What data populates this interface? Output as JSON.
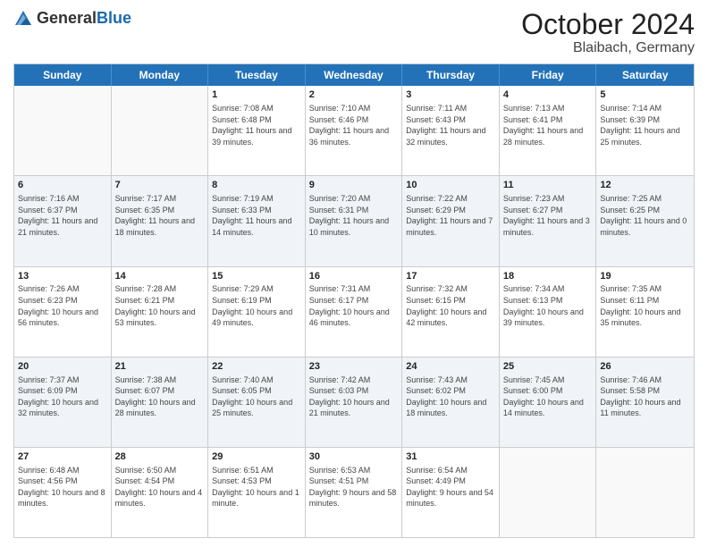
{
  "logo": {
    "text_general": "General",
    "text_blue": "Blue"
  },
  "title": {
    "month": "October 2024",
    "location": "Blaibach, Germany"
  },
  "days_of_week": [
    "Sunday",
    "Monday",
    "Tuesday",
    "Wednesday",
    "Thursday",
    "Friday",
    "Saturday"
  ],
  "weeks": [
    [
      {
        "day": "",
        "info": ""
      },
      {
        "day": "",
        "info": ""
      },
      {
        "day": "1",
        "info": "Sunrise: 7:08 AM\nSunset: 6:48 PM\nDaylight: 11 hours and 39 minutes."
      },
      {
        "day": "2",
        "info": "Sunrise: 7:10 AM\nSunset: 6:46 PM\nDaylight: 11 hours and 36 minutes."
      },
      {
        "day": "3",
        "info": "Sunrise: 7:11 AM\nSunset: 6:43 PM\nDaylight: 11 hours and 32 minutes."
      },
      {
        "day": "4",
        "info": "Sunrise: 7:13 AM\nSunset: 6:41 PM\nDaylight: 11 hours and 28 minutes."
      },
      {
        "day": "5",
        "info": "Sunrise: 7:14 AM\nSunset: 6:39 PM\nDaylight: 11 hours and 25 minutes."
      }
    ],
    [
      {
        "day": "6",
        "info": "Sunrise: 7:16 AM\nSunset: 6:37 PM\nDaylight: 11 hours and 21 minutes."
      },
      {
        "day": "7",
        "info": "Sunrise: 7:17 AM\nSunset: 6:35 PM\nDaylight: 11 hours and 18 minutes."
      },
      {
        "day": "8",
        "info": "Sunrise: 7:19 AM\nSunset: 6:33 PM\nDaylight: 11 hours and 14 minutes."
      },
      {
        "day": "9",
        "info": "Sunrise: 7:20 AM\nSunset: 6:31 PM\nDaylight: 11 hours and 10 minutes."
      },
      {
        "day": "10",
        "info": "Sunrise: 7:22 AM\nSunset: 6:29 PM\nDaylight: 11 hours and 7 minutes."
      },
      {
        "day": "11",
        "info": "Sunrise: 7:23 AM\nSunset: 6:27 PM\nDaylight: 11 hours and 3 minutes."
      },
      {
        "day": "12",
        "info": "Sunrise: 7:25 AM\nSunset: 6:25 PM\nDaylight: 11 hours and 0 minutes."
      }
    ],
    [
      {
        "day": "13",
        "info": "Sunrise: 7:26 AM\nSunset: 6:23 PM\nDaylight: 10 hours and 56 minutes."
      },
      {
        "day": "14",
        "info": "Sunrise: 7:28 AM\nSunset: 6:21 PM\nDaylight: 10 hours and 53 minutes."
      },
      {
        "day": "15",
        "info": "Sunrise: 7:29 AM\nSunset: 6:19 PM\nDaylight: 10 hours and 49 minutes."
      },
      {
        "day": "16",
        "info": "Sunrise: 7:31 AM\nSunset: 6:17 PM\nDaylight: 10 hours and 46 minutes."
      },
      {
        "day": "17",
        "info": "Sunrise: 7:32 AM\nSunset: 6:15 PM\nDaylight: 10 hours and 42 minutes."
      },
      {
        "day": "18",
        "info": "Sunrise: 7:34 AM\nSunset: 6:13 PM\nDaylight: 10 hours and 39 minutes."
      },
      {
        "day": "19",
        "info": "Sunrise: 7:35 AM\nSunset: 6:11 PM\nDaylight: 10 hours and 35 minutes."
      }
    ],
    [
      {
        "day": "20",
        "info": "Sunrise: 7:37 AM\nSunset: 6:09 PM\nDaylight: 10 hours and 32 minutes."
      },
      {
        "day": "21",
        "info": "Sunrise: 7:38 AM\nSunset: 6:07 PM\nDaylight: 10 hours and 28 minutes."
      },
      {
        "day": "22",
        "info": "Sunrise: 7:40 AM\nSunset: 6:05 PM\nDaylight: 10 hours and 25 minutes."
      },
      {
        "day": "23",
        "info": "Sunrise: 7:42 AM\nSunset: 6:03 PM\nDaylight: 10 hours and 21 minutes."
      },
      {
        "day": "24",
        "info": "Sunrise: 7:43 AM\nSunset: 6:02 PM\nDaylight: 10 hours and 18 minutes."
      },
      {
        "day": "25",
        "info": "Sunrise: 7:45 AM\nSunset: 6:00 PM\nDaylight: 10 hours and 14 minutes."
      },
      {
        "day": "26",
        "info": "Sunrise: 7:46 AM\nSunset: 5:58 PM\nDaylight: 10 hours and 11 minutes."
      }
    ],
    [
      {
        "day": "27",
        "info": "Sunrise: 6:48 AM\nSunset: 4:56 PM\nDaylight: 10 hours and 8 minutes."
      },
      {
        "day": "28",
        "info": "Sunrise: 6:50 AM\nSunset: 4:54 PM\nDaylight: 10 hours and 4 minutes."
      },
      {
        "day": "29",
        "info": "Sunrise: 6:51 AM\nSunset: 4:53 PM\nDaylight: 10 hours and 1 minute."
      },
      {
        "day": "30",
        "info": "Sunrise: 6:53 AM\nSunset: 4:51 PM\nDaylight: 9 hours and 58 minutes."
      },
      {
        "day": "31",
        "info": "Sunrise: 6:54 AM\nSunset: 4:49 PM\nDaylight: 9 hours and 54 minutes."
      },
      {
        "day": "",
        "info": ""
      },
      {
        "day": "",
        "info": ""
      }
    ]
  ]
}
